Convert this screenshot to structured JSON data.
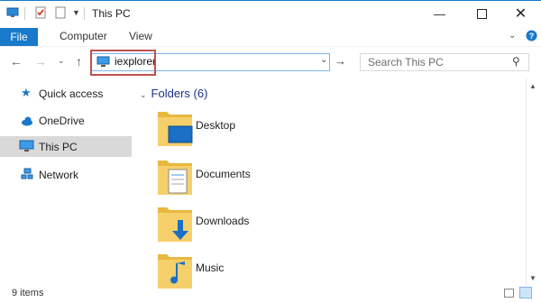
{
  "window": {
    "title": "This PC"
  },
  "ribbon": {
    "tabs": [
      "File",
      "Computer",
      "View"
    ]
  },
  "address": {
    "value": "iexplorer"
  },
  "search": {
    "placeholder": "Search This PC"
  },
  "nav": {
    "items": [
      {
        "label": "Quick access",
        "icon": "star-icon",
        "selected": false
      },
      {
        "label": "OneDrive",
        "icon": "cloud-icon",
        "selected": false
      },
      {
        "label": "This PC",
        "icon": "computer-icon",
        "selected": true
      },
      {
        "label": "Network",
        "icon": "network-icon",
        "selected": false
      }
    ]
  },
  "content": {
    "section_title": "Folders (6)",
    "folders": [
      "Desktop",
      "Documents",
      "Downloads",
      "Music"
    ]
  },
  "status": {
    "items": "9 items"
  },
  "colors": {
    "accent": "#1979ca",
    "folder": "#f2c84b",
    "highlight": "#c0504d"
  }
}
